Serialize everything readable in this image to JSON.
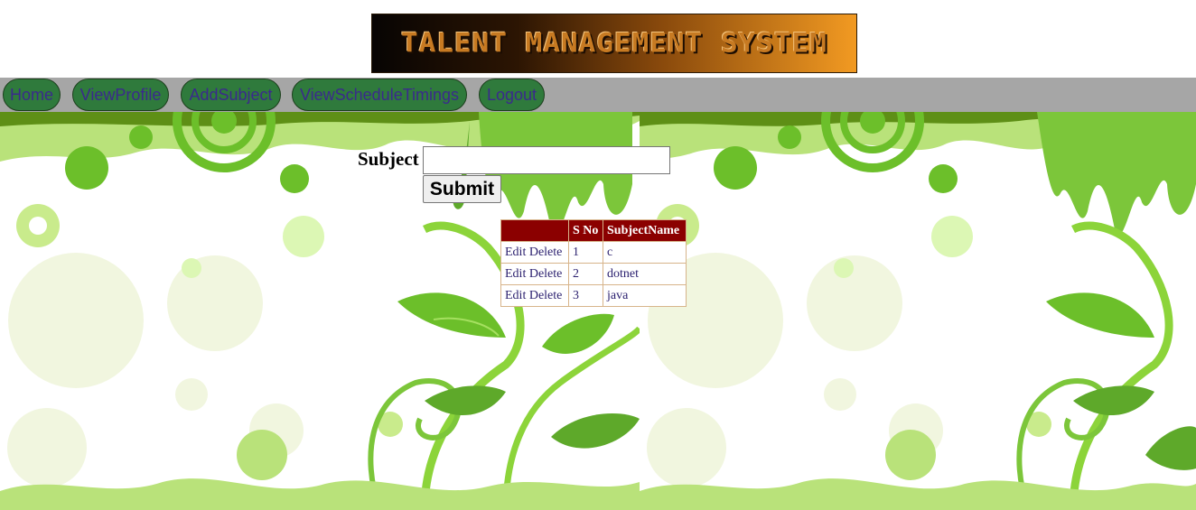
{
  "header": {
    "banner_text": "TALENT MANAGEMENT SYSTEM",
    "banner_gradient": [
      "#070403",
      "#f29a22"
    ]
  },
  "nav": {
    "items": [
      {
        "label": "Home"
      },
      {
        "label": "ViewProfile"
      },
      {
        "label": "AddSubject"
      },
      {
        "label": "ViewScheduleTimings"
      },
      {
        "label": "Logout"
      }
    ],
    "button_color": "#2f7a3c",
    "text_color": "#3a2a8c",
    "bar_color": "#a6a6a6"
  },
  "form": {
    "subject_label": "Subject",
    "subject_value": "",
    "submit_label": "Submit"
  },
  "table": {
    "headers": [
      "",
      "S No",
      "SubjectName"
    ],
    "rows": [
      {
        "edit": "Edit",
        "delete": "Delete",
        "sno": "1",
        "name": "c"
      },
      {
        "edit": "Edit",
        "delete": "Delete",
        "sno": "2",
        "name": "dotnet"
      },
      {
        "edit": "Edit",
        "delete": "Delete",
        "sno": "3",
        "name": "java"
      }
    ],
    "header_color": "#8b0000"
  }
}
